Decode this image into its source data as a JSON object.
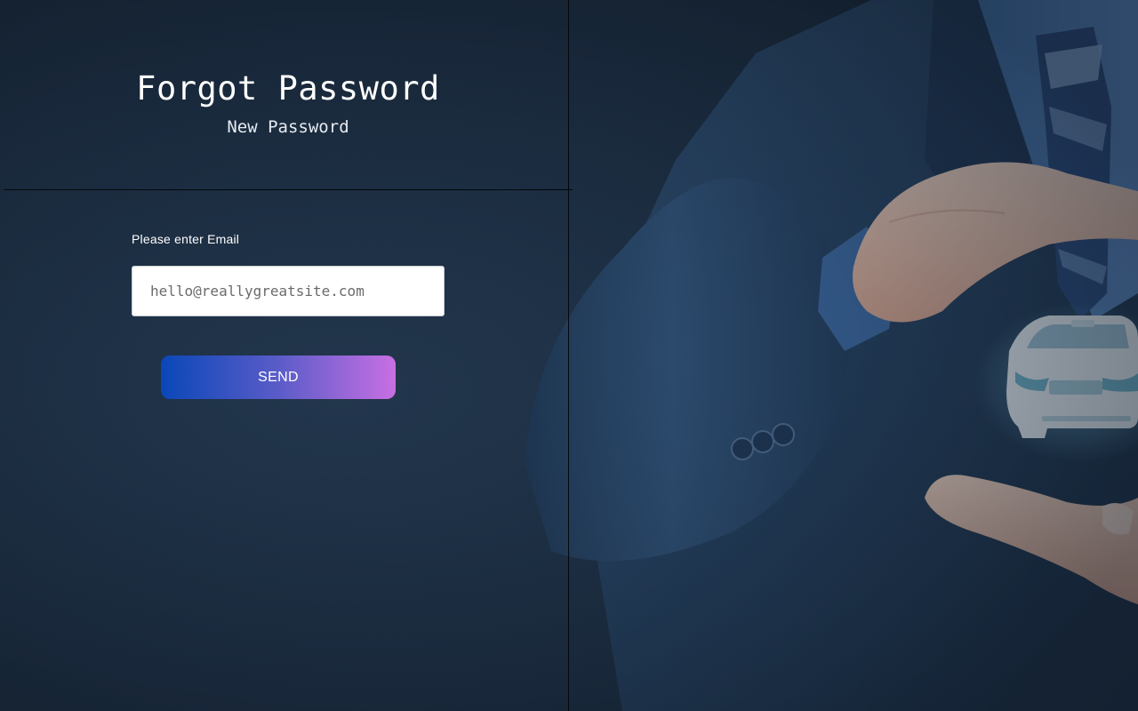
{
  "header": {
    "title": "Forgot Password",
    "subtitle": "New Password"
  },
  "form": {
    "email_label": "Please enter Email",
    "email_placeholder": "hello@reallygreatsite.com",
    "email_value": "",
    "send_label": "SEND"
  },
  "colors": {
    "background": "#1b2a3c",
    "button_gradient_start": "#0a47b8",
    "button_gradient_end": "#c86fe3",
    "suit": "#24405f"
  },
  "hero": {
    "icon": "car-insurance-hands-illustration"
  }
}
